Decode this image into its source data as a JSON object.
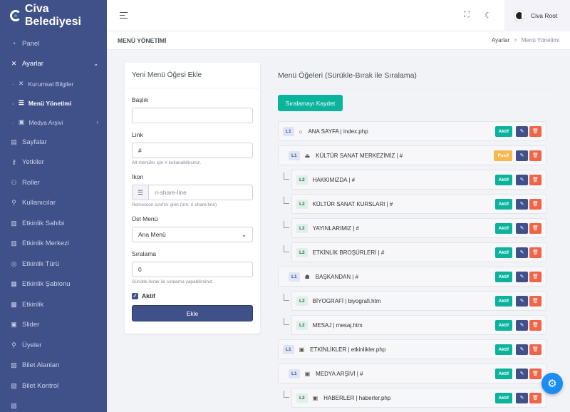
{
  "app": {
    "brand": "Civa Belediyesi",
    "user": "Civa Root"
  },
  "sidebar": [
    {
      "key": "panel",
      "label": "Panel",
      "icon": "dashboard-icon"
    },
    {
      "key": "ayarlar",
      "label": "Ayarlar",
      "icon": "wrench-icon",
      "expanded": true
    },
    {
      "key": "kurumsal",
      "label": "Kurumsal Bilgiler",
      "icon": "tools-icon",
      "sub": true
    },
    {
      "key": "menu",
      "label": "Menü Yönetimi",
      "icon": "list-icon",
      "sub": true,
      "active": true
    },
    {
      "key": "medya",
      "label": "Medya Arşivi",
      "icon": "image-icon",
      "sub": true,
      "chevron": true
    },
    {
      "key": "sayfalar",
      "label": "Sayfalar",
      "icon": "file-icon"
    },
    {
      "key": "yetkiler",
      "label": "Yetkiler",
      "icon": "key-icon"
    },
    {
      "key": "roller",
      "label": "Roller",
      "icon": "users-icon"
    },
    {
      "key": "kullanicilar",
      "label": "Kullanıcılar",
      "icon": "user-icon"
    },
    {
      "key": "etkinlik-sahibi",
      "label": "Etkinlik Sahibi",
      "icon": "building-icon"
    },
    {
      "key": "etkinlik-merkezi",
      "label": "Etkinlik Merkezi",
      "icon": "building-icon"
    },
    {
      "key": "etkinlik-turu",
      "label": "Etkinlik Türü",
      "icon": "tag-icon"
    },
    {
      "key": "etkinlik-sablonu",
      "label": "Etkinlik Şablonu",
      "icon": "layout-icon"
    },
    {
      "key": "etkinlik",
      "label": "Etkinlik",
      "icon": "calendar-icon"
    },
    {
      "key": "slider",
      "label": "Slider",
      "icon": "image-icon"
    },
    {
      "key": "uyeler",
      "label": "Üyeler",
      "icon": "user-icon"
    },
    {
      "key": "bilet-alanlari",
      "label": "Bilet Alanları",
      "icon": "ticket-icon"
    },
    {
      "key": "bilet-kontrol",
      "label": "Bilet Kontrol",
      "icon": "ticket-icon"
    },
    {
      "key": "bilet-satis",
      "label": "",
      "icon": "ticket-icon"
    }
  ],
  "header": {
    "title": "MENÜ YÖNETİMİ",
    "breadcrumb": [
      "Ayarlar",
      "Menü Yönetimi"
    ]
  },
  "form": {
    "title": "Yeni Menü Öğesi Ekle",
    "baslik_label": "Başlık",
    "baslik_value": "",
    "link_label": "Link",
    "link_value": "#",
    "link_hint": "Alt menüler için # kullanabilirsiniz.",
    "ikon_label": "İkon",
    "ikon_placeholder": "ri-share-line",
    "ikon_hint": "Remixicon sınıfını girin (örn: ri-share-line)",
    "ust_label": "Üst Menü",
    "ust_value": "Ana Menü",
    "sira_label": "Sıralama",
    "sira_value": "0",
    "sira_hint": "Sürükle-bırak ile sıralama yapabilirsiniz.",
    "aktif_label": "Aktif",
    "submit": "Ekle"
  },
  "list": {
    "title": "Menü Öğeleri (Sürükle-Bırak ile Sıralama)",
    "save": "Sıralamayı Kaydet",
    "items": [
      {
        "level": "L1",
        "icon": "home-icon",
        "glyph": "⌂",
        "text": "ANA SAYFA | index.php",
        "status": "Aktif",
        "indent": 0
      },
      {
        "level": "L1",
        "icon": "building-icon",
        "glyph": "⏏",
        "text": "KÜLTÜR SANAT MERKEZİMİZ | #",
        "status": "Pasif",
        "indent": 1
      },
      {
        "level": "L2",
        "icon": "",
        "glyph": "",
        "text": "HAKKIMIZDA | #",
        "status": "Aktif",
        "indent": 2
      },
      {
        "level": "L2",
        "icon": "",
        "glyph": "",
        "text": "KÜLTÜR SANAT KURSLARI | #",
        "status": "Aktif",
        "indent": 2
      },
      {
        "level": "L2",
        "icon": "",
        "glyph": "",
        "text": "YAYINLARIMIZ | #",
        "status": "Aktif",
        "indent": 2
      },
      {
        "level": "L2",
        "icon": "",
        "glyph": "",
        "text": "ETKİNLİK BROŞÜRLERİ | #",
        "status": "Aktif",
        "indent": 2
      },
      {
        "level": "L1",
        "icon": "user-icon",
        "glyph": "☗",
        "text": "BAŞKANDAN | #",
        "status": "Aktif",
        "indent": 1
      },
      {
        "level": "L2",
        "icon": "",
        "glyph": "",
        "text": "BİYOGRAFİ | biyografi.htm",
        "status": "Aktif",
        "indent": 2
      },
      {
        "level": "L2",
        "icon": "",
        "glyph": "",
        "text": "MESAJ | mesaj.htm",
        "status": "Aktif",
        "indent": 2
      },
      {
        "level": "L1",
        "icon": "image-icon",
        "glyph": "▣",
        "text": "ETKİNLİKLER | etkinlikler.php",
        "status": "Aktif",
        "indent": 0
      },
      {
        "level": "L1",
        "icon": "image-icon",
        "glyph": "▣",
        "text": "MEDYA ARŞİVİ | #",
        "status": "Aktif",
        "indent": 1
      },
      {
        "level": "L2",
        "icon": "image-icon",
        "glyph": "▣",
        "text": "HABERLER | haberler.php",
        "status": "Aktif",
        "indent": 2
      },
      {
        "level": "",
        "icon": "",
        "glyph": "",
        "text": "",
        "status": "",
        "indent": 2
      }
    ]
  }
}
